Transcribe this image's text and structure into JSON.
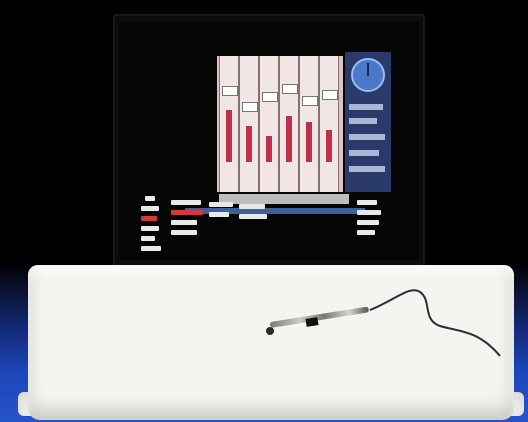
{
  "scene": {
    "objects": [
      "monitor",
      "mixer-interface",
      "graphics-tablet",
      "stylus-pen",
      "pen-cable"
    ],
    "colors": {
      "background_top": "#000000",
      "background_floor": "#2454c8",
      "tablet": "#f4f4f0",
      "screen_accent_red": "#c0304a",
      "screen_accent_blue": "#4a79c7"
    }
  }
}
